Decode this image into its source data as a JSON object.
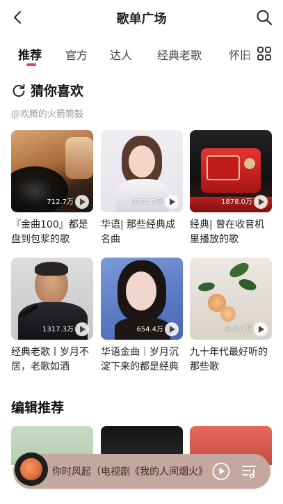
{
  "header": {
    "title": "歌单广场",
    "back_icon": "chevron-left-icon",
    "search_icon": "search-icon"
  },
  "tabs": [
    {
      "label": "推荐",
      "active": true
    },
    {
      "label": "官方",
      "active": false
    },
    {
      "label": "达人",
      "active": false
    },
    {
      "label": "经典老歌",
      "active": false
    },
    {
      "label": "怀旧",
      "active": false
    }
  ],
  "tabs_more_icon": "grid-icon",
  "accent_color": "#f0395e",
  "guess": {
    "title": "猜你喜欢",
    "subtitle": "@欢腾的火箭筒鼓",
    "cards": [
      {
        "title": "『金曲100』都是盘到包浆的歌",
        "plays": "712.7万"
      },
      {
        "title": "华语| 那些经典成名曲",
        "plays": "4232.7万"
      },
      {
        "title": "经典| 曾在收音机里播放的歌",
        "plays": "1878.0万"
      },
      {
        "title": "经典老歌丨岁月不居，老歌如酒",
        "plays": "1317.3万"
      },
      {
        "title": "华语金曲｜岁月沉淀下来的都是经典",
        "plays": "654.4万"
      },
      {
        "title": "九十年代最好听的那些歌",
        "plays": "848.9万"
      }
    ]
  },
  "editor": {
    "title": "编辑推荐"
  },
  "player": {
    "now_playing": "你时风起（电视剧《我的人间烟火》",
    "background": "#c5a89d"
  }
}
